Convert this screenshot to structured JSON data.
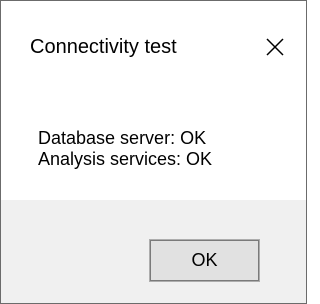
{
  "dialog": {
    "title": "Connectivity test",
    "close_glyph": "×",
    "messages": [
      "Database server: OK",
      "Analysis services: OK"
    ],
    "ok_label": "OK"
  },
  "icons": {
    "close": "close-icon"
  },
  "colors": {
    "footer_background": "#f0f0f0",
    "button_background": "#e1e1e1",
    "button_border": "#adadad",
    "window_border": "#6b6b6b"
  }
}
